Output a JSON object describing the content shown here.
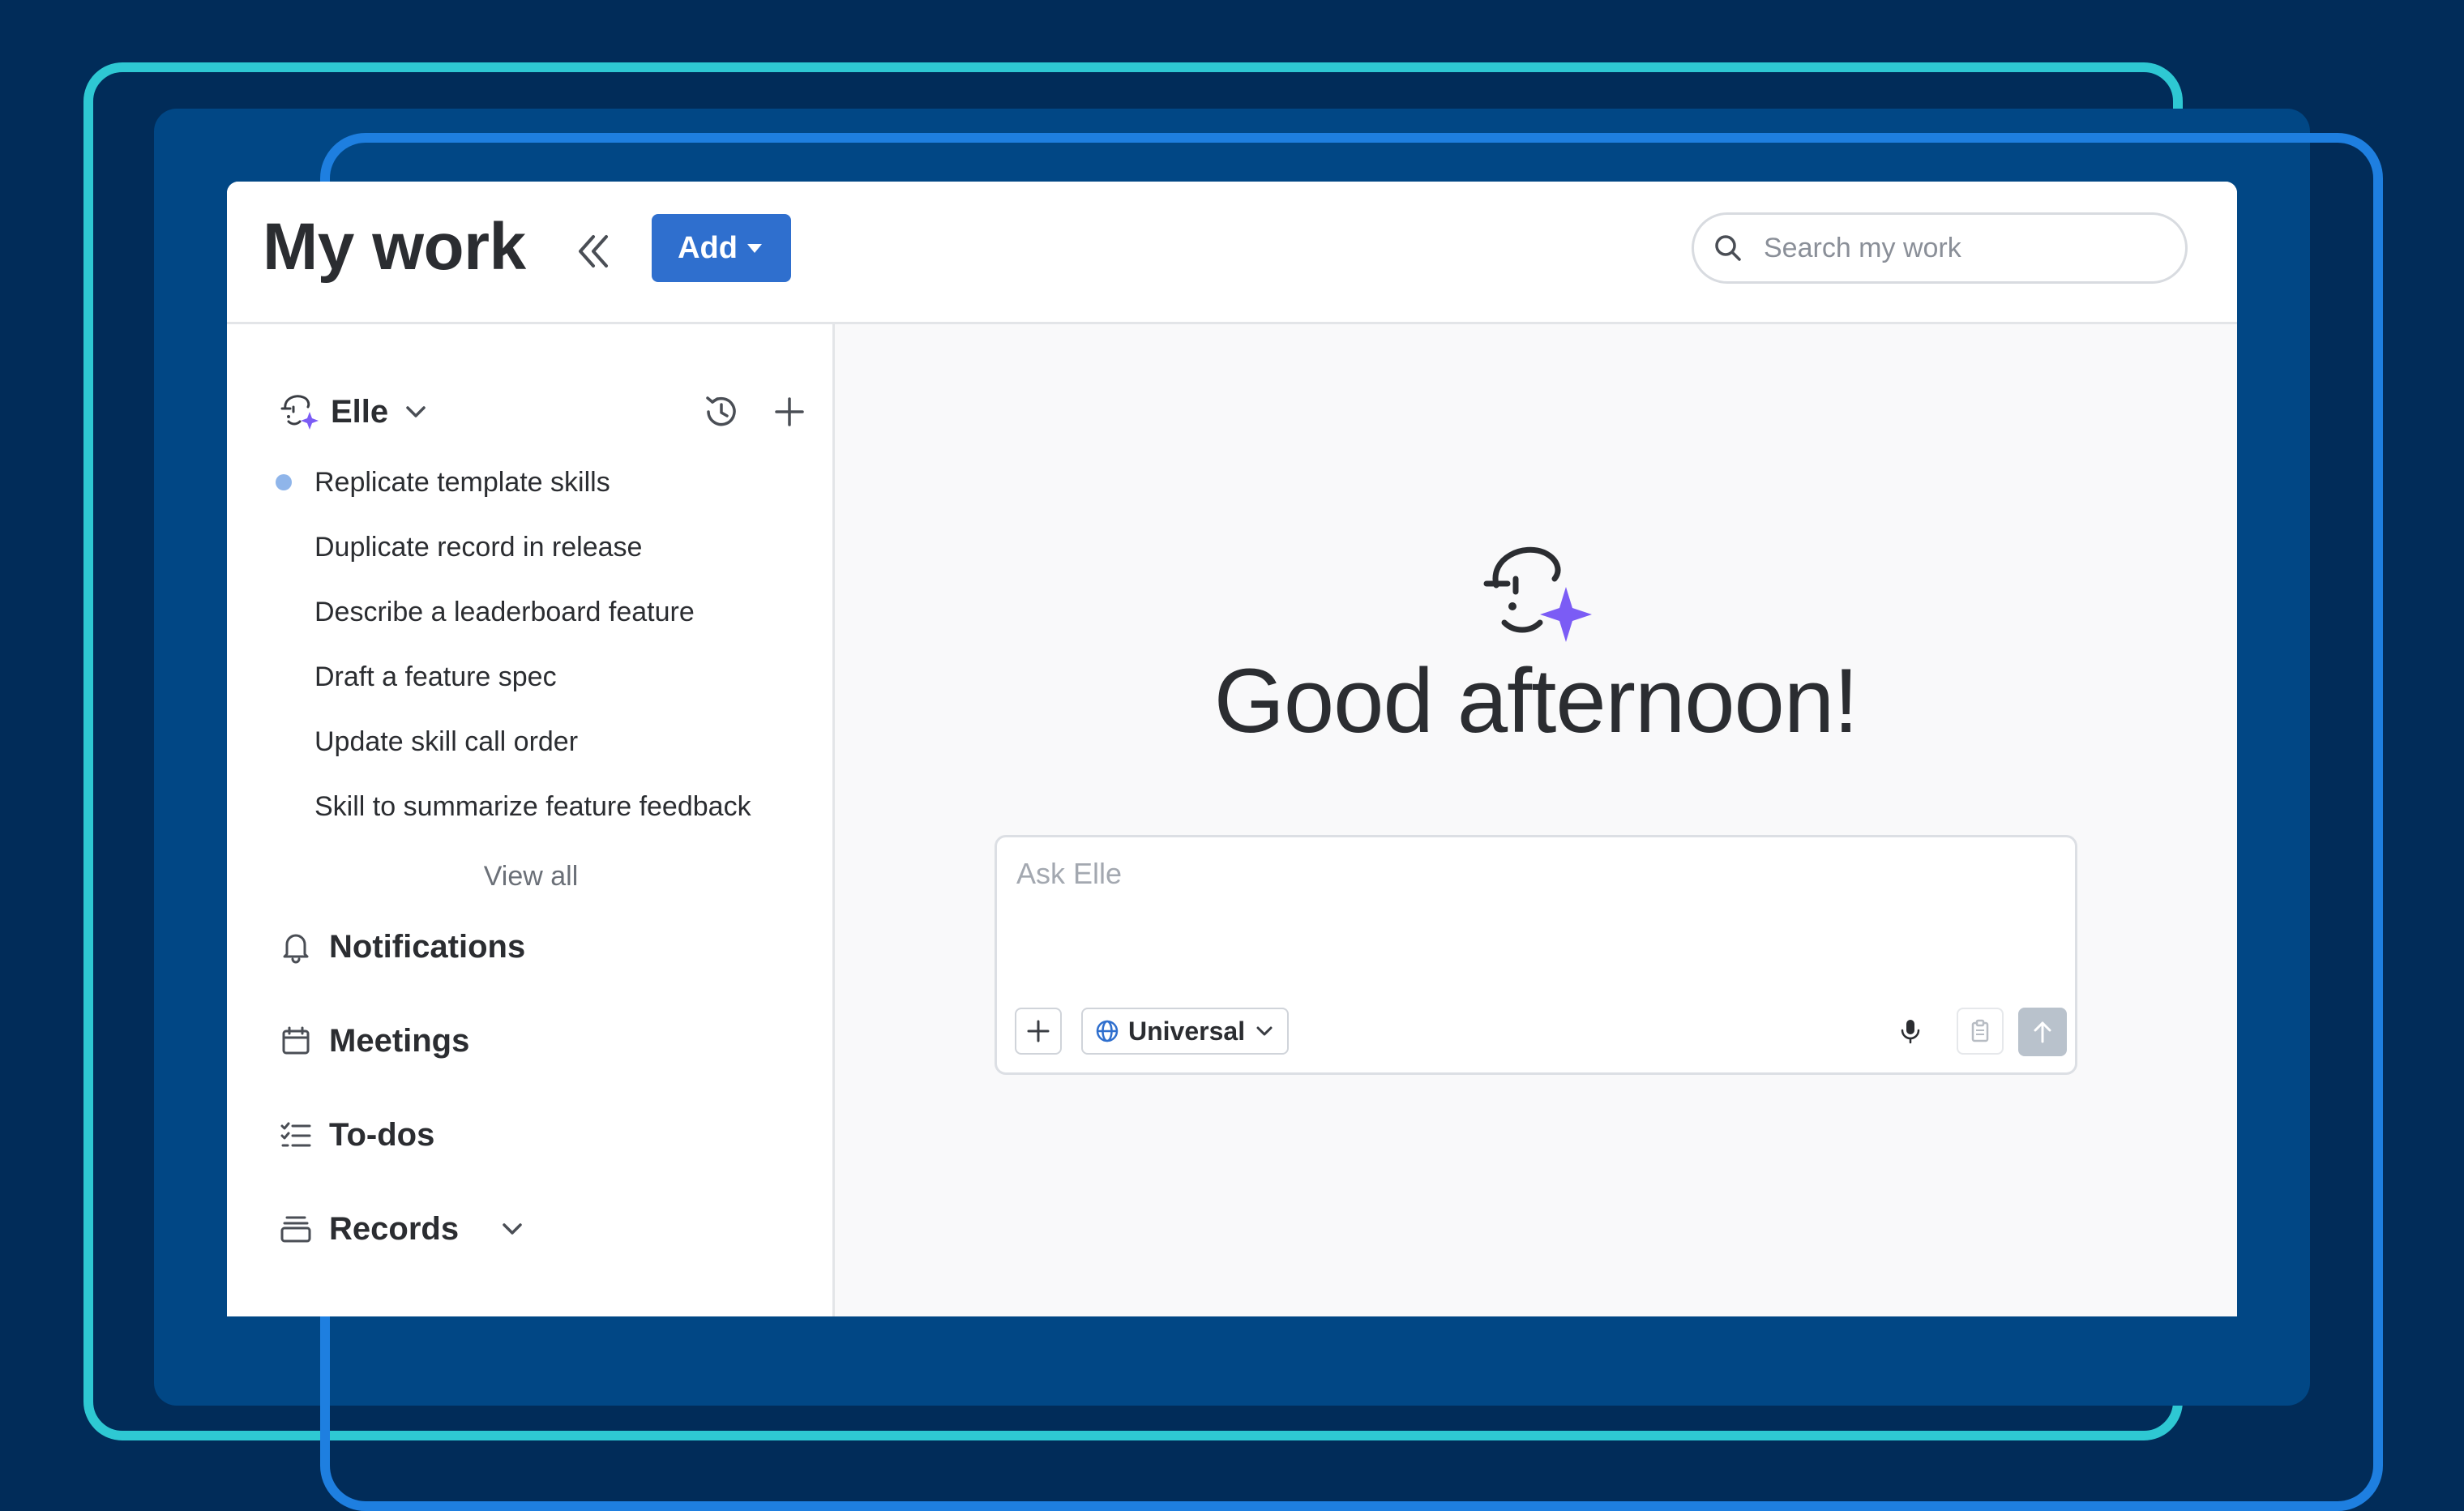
{
  "header": {
    "title": "My work",
    "add_label": "Add",
    "search_placeholder": "Search my work"
  },
  "sidebar": {
    "assistant_name": "Elle",
    "chats": [
      {
        "label": "Replicate template skills",
        "unread": true
      },
      {
        "label": "Duplicate record in release",
        "unread": false
      },
      {
        "label": "Describe a leaderboard feature",
        "unread": false
      },
      {
        "label": "Draft a feature spec",
        "unread": false
      },
      {
        "label": "Update skill call order",
        "unread": false
      },
      {
        "label": "Skill to summarize feature feedback",
        "unread": false
      }
    ],
    "view_all": "View all",
    "nav": [
      {
        "label": "Notifications",
        "icon": "bell-icon"
      },
      {
        "label": "Meetings",
        "icon": "calendar-icon"
      },
      {
        "label": "To-dos",
        "icon": "checklist-icon"
      },
      {
        "label": "Records",
        "icon": "records-icon"
      }
    ]
  },
  "main": {
    "greeting": "Good afternoon!",
    "composer": {
      "placeholder": "Ask Elle",
      "scope": "Universal"
    }
  },
  "colors": {
    "background": "#012c59",
    "accent": "#2f6fce",
    "frame_teal": "#2ec8d3",
    "frame_blue": "#1e7fe0",
    "sparkle_purple": "#7b5cf5",
    "unread_dot": "#8fb5ea"
  }
}
